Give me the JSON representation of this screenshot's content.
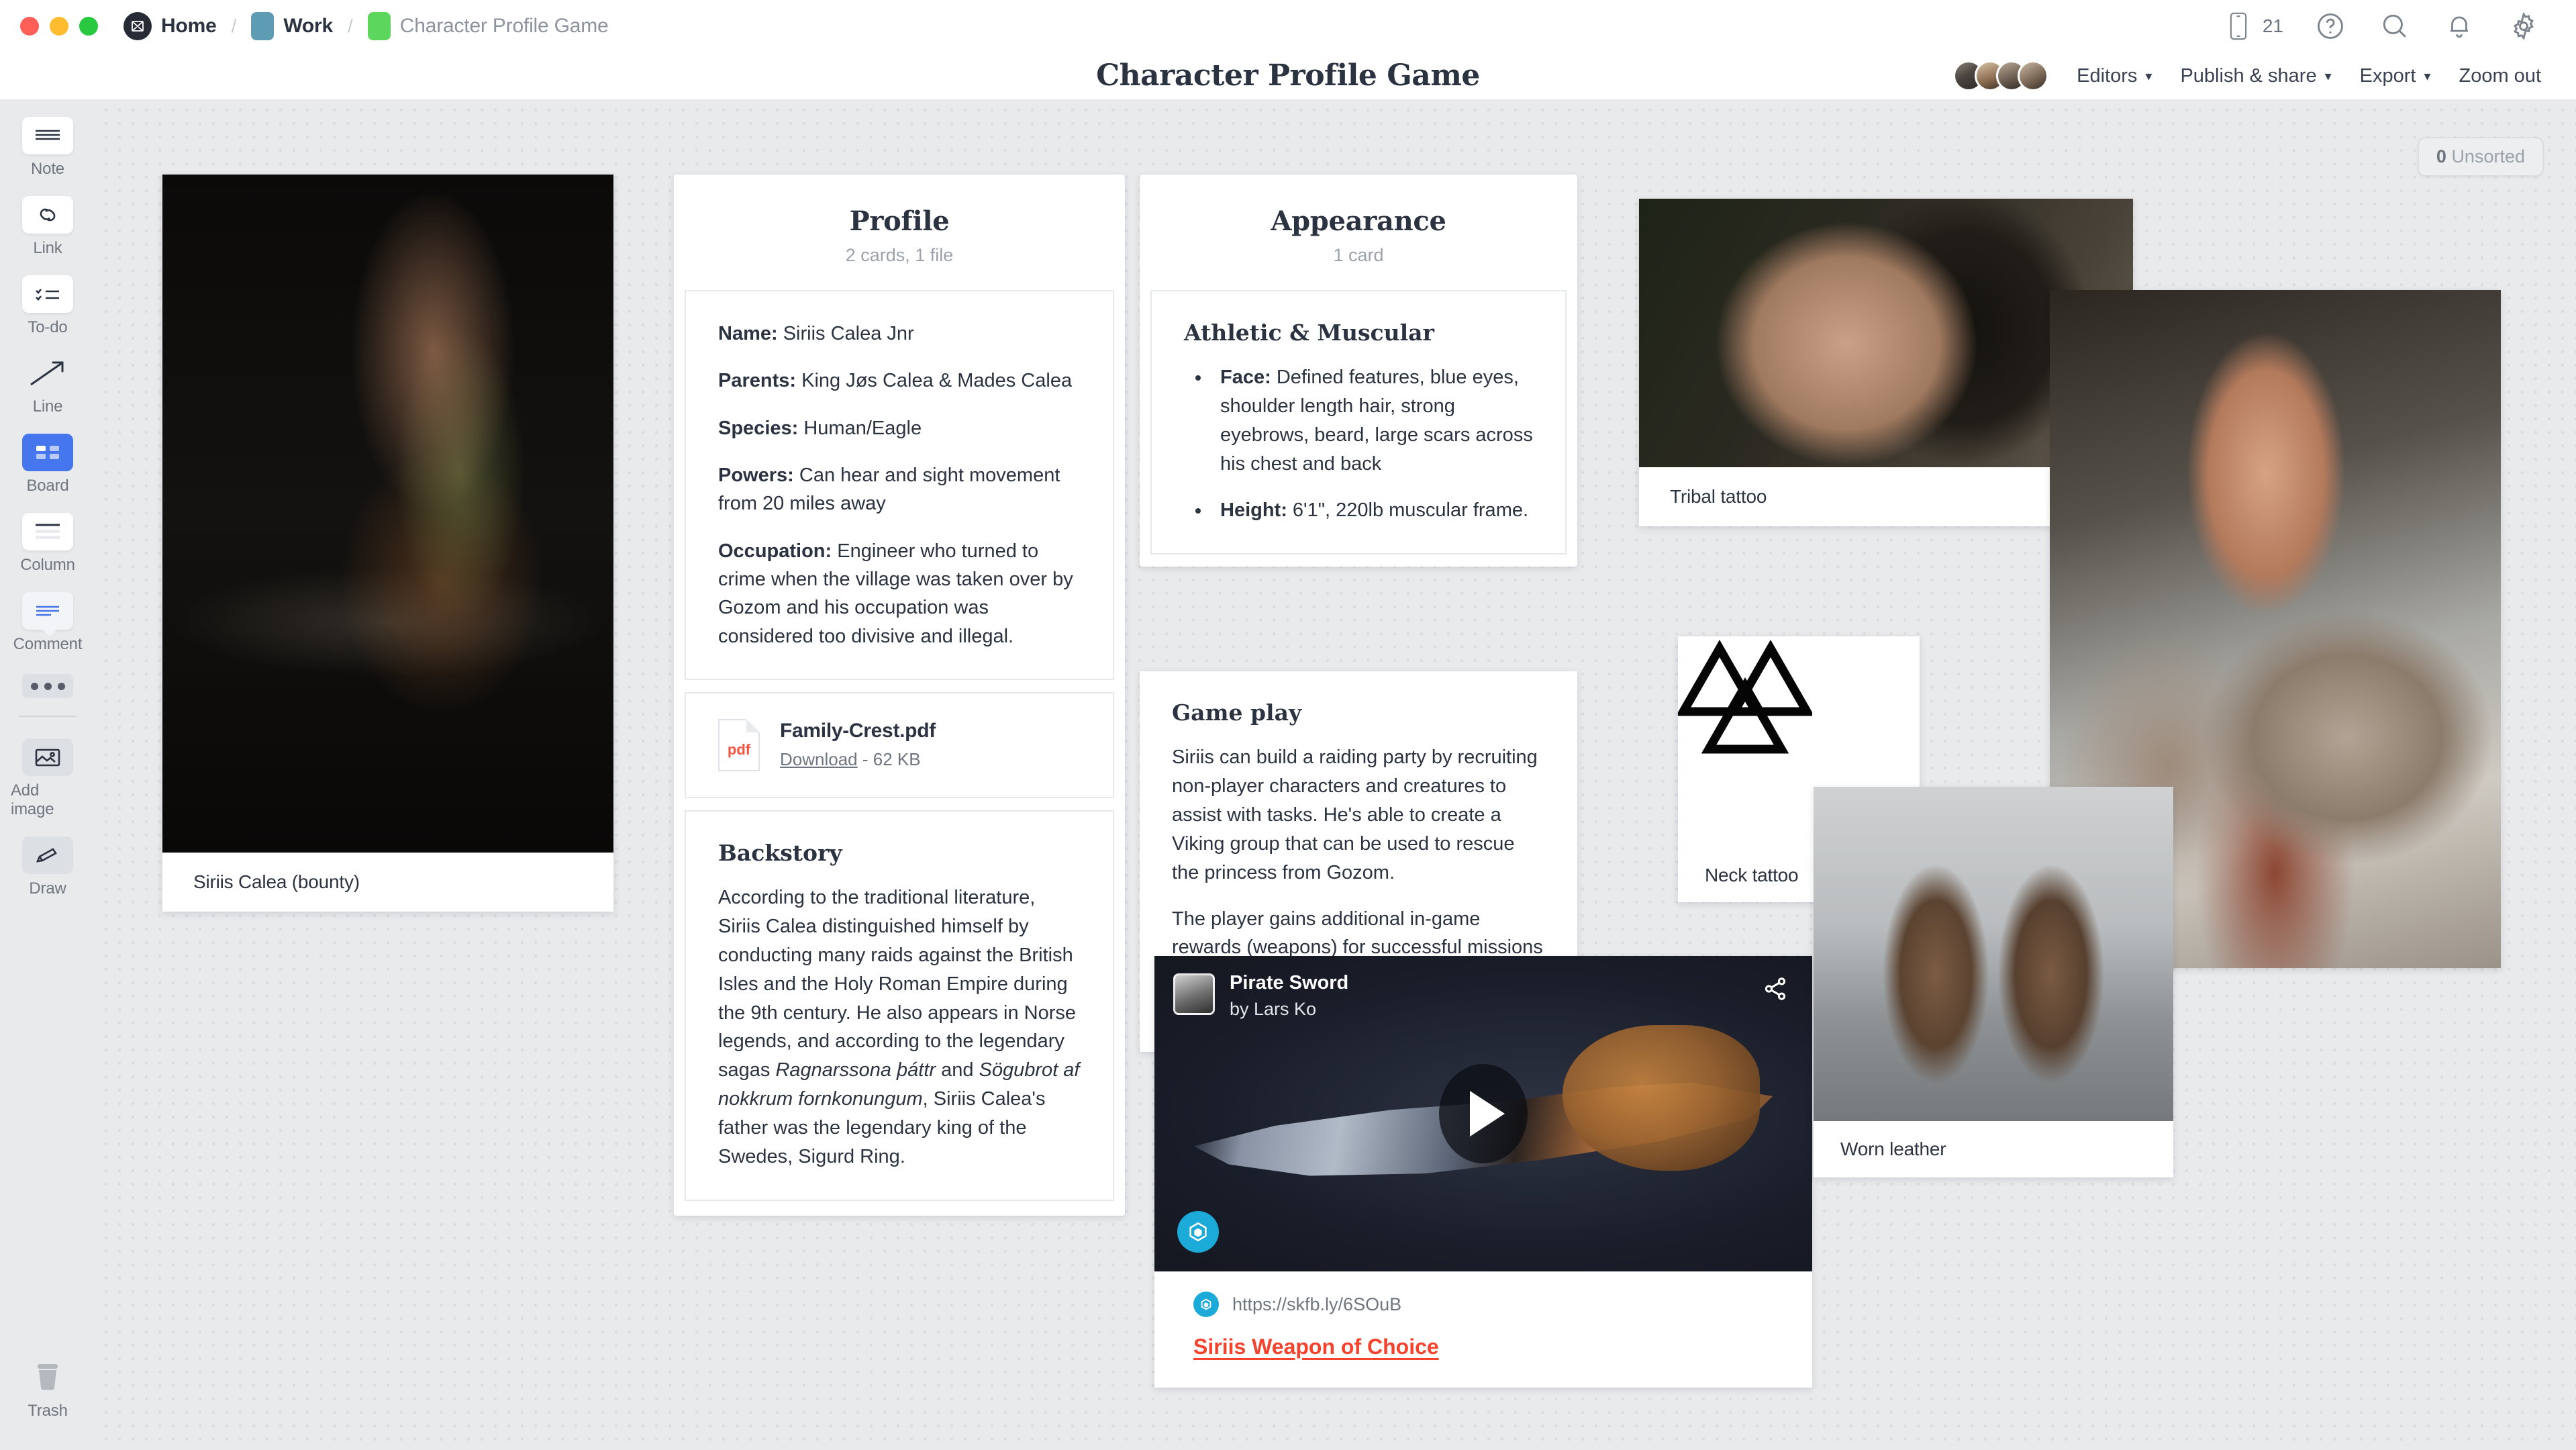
{
  "window": {
    "traffic_lights": [
      "close",
      "minimize",
      "maximize"
    ]
  },
  "breadcrumb": {
    "home": "Home",
    "work": "Work",
    "current": "Character Profile Game",
    "separator": "/"
  },
  "topbar": {
    "device_count": "21",
    "icons": [
      "mobile-icon",
      "help-icon",
      "search-icon",
      "bell-icon",
      "gear-icon"
    ]
  },
  "header": {
    "board_title": "Character Profile Game",
    "editors_label": "Editors",
    "publish_label": "Publish & share",
    "export_label": "Export",
    "zoom_out_label": "Zoom out",
    "avatar_count": 4
  },
  "toolbar": {
    "items": [
      {
        "label": "Note",
        "icon": "note-icon",
        "state": "default"
      },
      {
        "label": "Link",
        "icon": "link-icon",
        "state": "default"
      },
      {
        "label": "To-do",
        "icon": "todo-icon",
        "state": "default"
      },
      {
        "label": "Line",
        "icon": "line-icon",
        "state": "flat"
      },
      {
        "label": "Board",
        "icon": "board-icon",
        "state": "selected"
      },
      {
        "label": "Column",
        "icon": "column-icon",
        "state": "default"
      },
      {
        "label": "Comment",
        "icon": "comment-icon",
        "state": "default"
      }
    ],
    "more_label": "more-options",
    "add_image_label": "Add image",
    "draw_label": "Draw",
    "trash_label": "Trash"
  },
  "canvas": {
    "unsorted_count": "0",
    "unsorted_label": "Unsorted"
  },
  "cards": {
    "bounty_photo": {
      "caption": "Siriis Calea (bounty)"
    },
    "profile": {
      "title": "Profile",
      "subtitle": "2 cards, 1 file",
      "fields": [
        {
          "key": "Name:",
          "value": " Siriis Calea Jnr"
        },
        {
          "key": "Parents:",
          "value": " King Jøs Calea & Mades Calea"
        },
        {
          "key": "Species:",
          "value": " Human/Eagle"
        },
        {
          "key": "Powers:",
          "value": " Can hear and sight movement from 20 miles away"
        },
        {
          "key": "Occupation:",
          "value": " Engineer who turned to crime when the village was taken over by Gozom and his occupation was considered too divisive and illegal."
        }
      ],
      "file": {
        "name": "Family-Crest.pdf",
        "type_label": "pdf",
        "download_label": "Download",
        "size": " - 62 KB"
      },
      "backstory": {
        "heading": "Backstory",
        "text_pre": "According to the traditional literature, Siriis Calea distinguished himself by conducting many raids against the British Isles and the Holy Roman Empire during the 9th century. He also appears in Norse legends, and according to the legendary sagas ",
        "italic_one": "Ragnarssona þáttr",
        "text_mid": " and ",
        "italic_two": "Sögubrot af nokkrum fornkonungum",
        "text_post": ", Siriis Calea's father was the legendary king of the Swedes, Sigurd Ring."
      }
    },
    "appearance": {
      "title": "Appearance",
      "subtitle": "1 card",
      "heading": "Athletic & Muscular",
      "bullets": [
        {
          "key": "Face:",
          "value": " Defined features, blue eyes, shoulder length hair, strong eyebrows, beard, large scars across his chest and back"
        },
        {
          "key": "Height:",
          "value": " 6'1\", 220lb muscular frame."
        }
      ],
      "gameplay": {
        "heading": "Game play",
        "paragraphs": [
          "Siriis can build a raiding party by recruiting non-player characters and creatures to assist with tasks. He's able to create a Viking group that can be used to rescue the princess from Gozom.",
          "The player gains additional in-game rewards (weapons) for successful missions like making his way through the villages and forests to the Gozom's castle."
        ]
      }
    },
    "tribal_tattoo": {
      "caption": "Tribal tattoo"
    },
    "neck_tattoo": {
      "caption": "Neck tattoo"
    },
    "worn_leather": {
      "caption": "Worn leather"
    },
    "viking_photo": {
      "caption": ""
    },
    "embed": {
      "title": "Pirate Sword",
      "author": "by Lars Ko",
      "url": "https://skfb.ly/6SOuB",
      "link_label": "Siriis Weapon of Choice",
      "play_label": "play-button",
      "share_label": "share-button"
    }
  },
  "colors": {
    "accent": "#4676ee",
    "link_red": "#f4422c",
    "board_bg": "#e8eaec",
    "text": "#2b3240",
    "muted": "#9ba1aa",
    "tag_work": "#5d9cb3",
    "tag_game": "#5cd65c"
  }
}
